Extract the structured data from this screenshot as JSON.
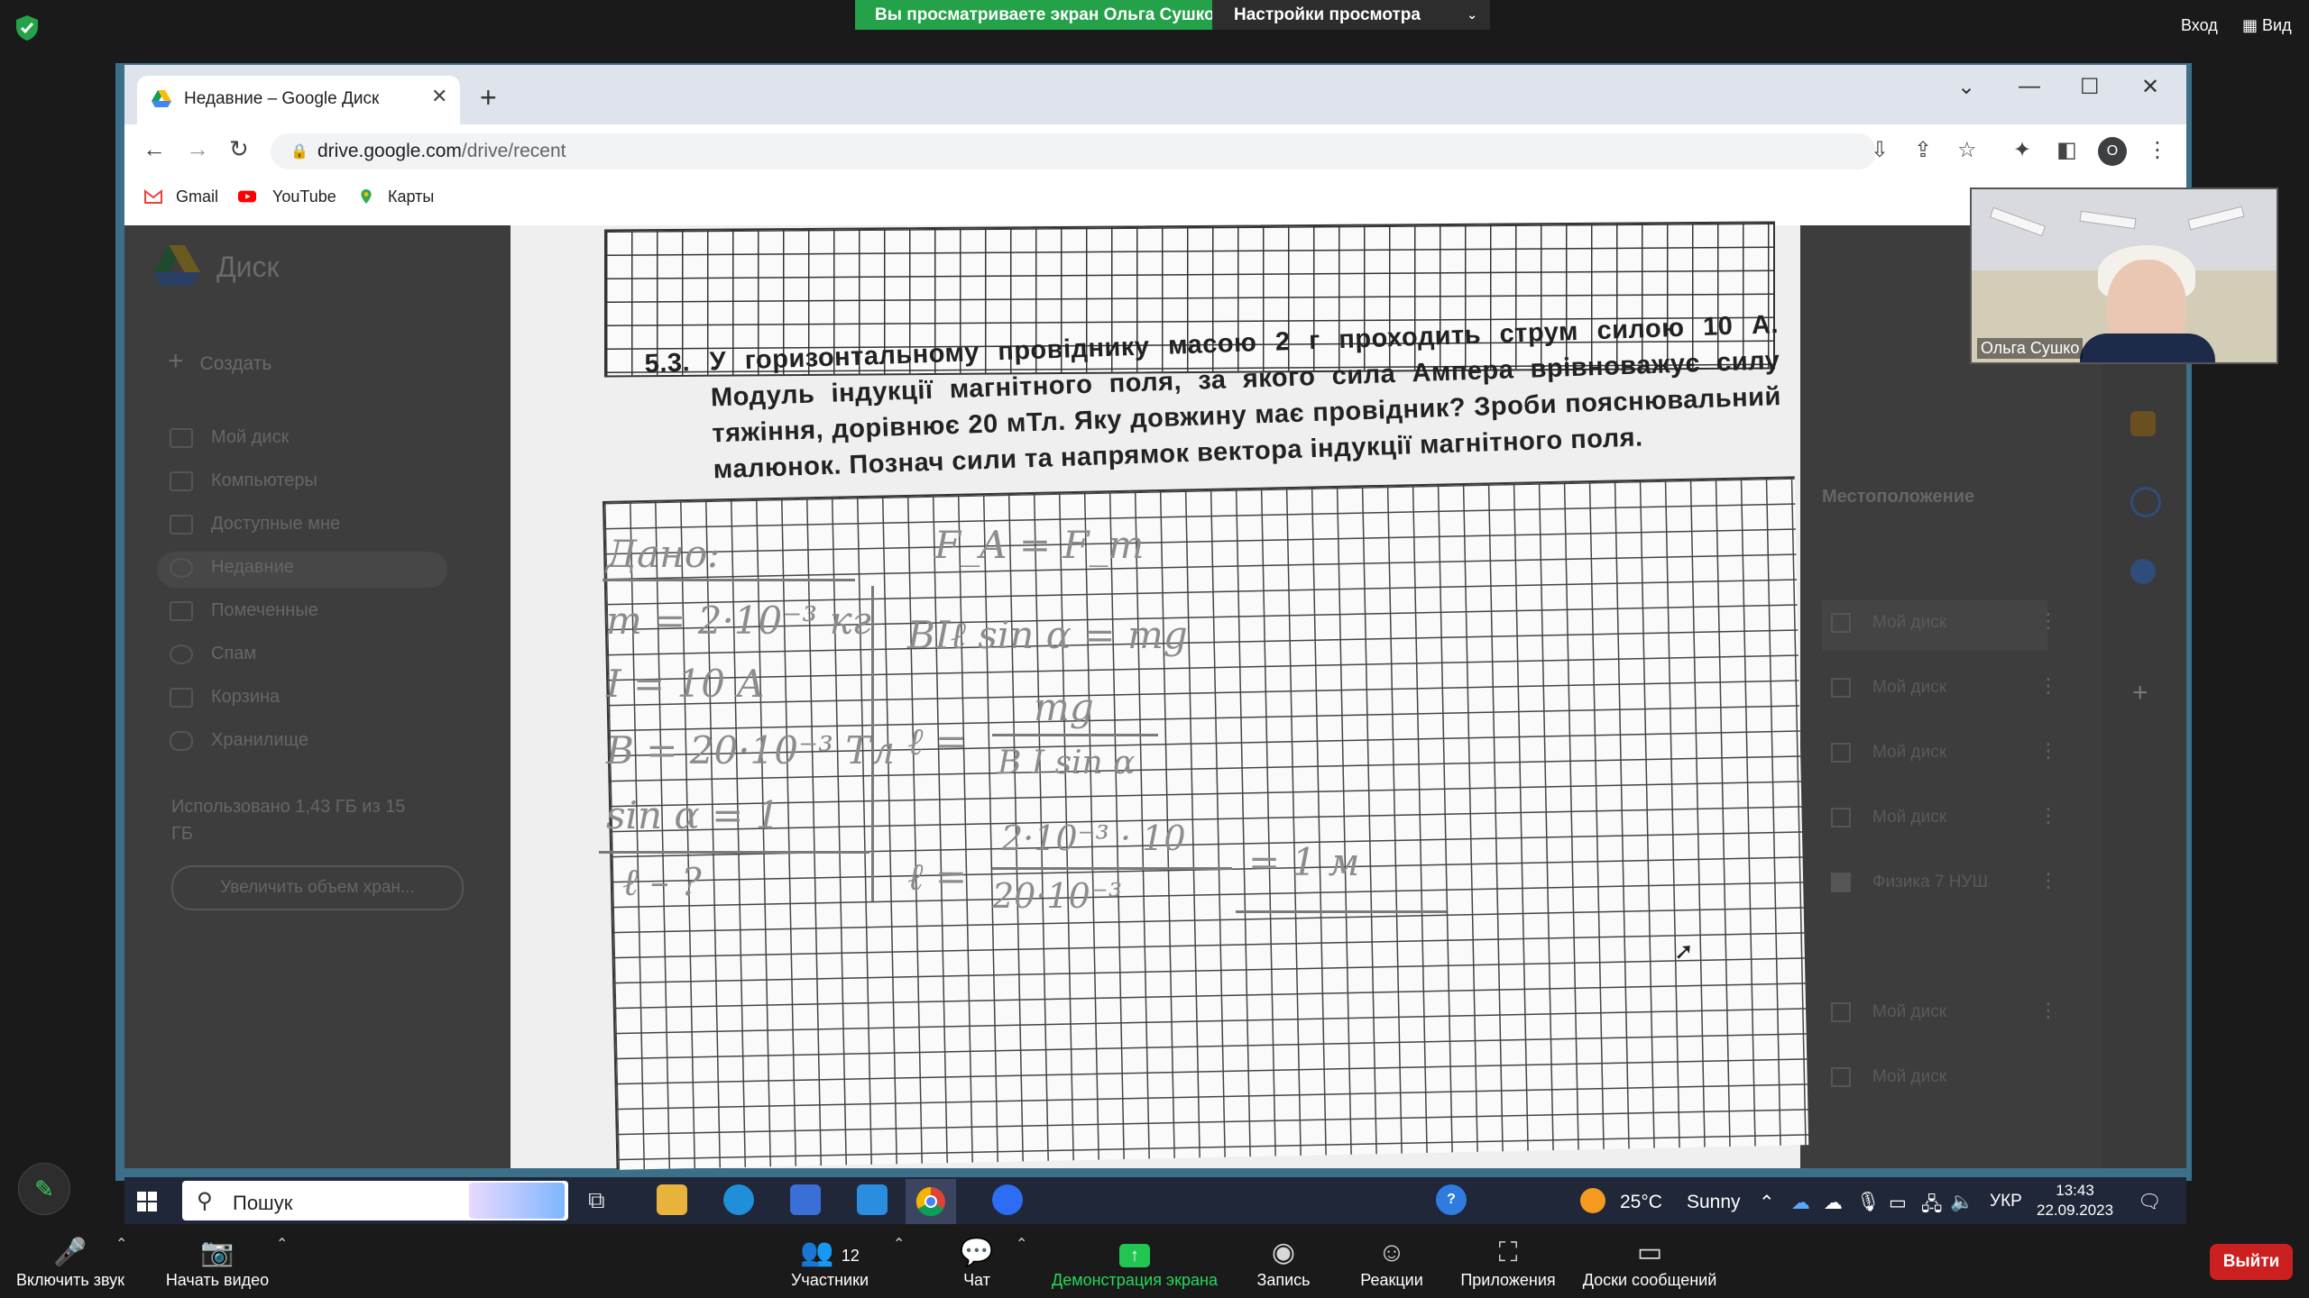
{
  "zoom": {
    "share_banner": "Вы просматриваете экран Ольга Сушко",
    "view_options": "Настройки просмотра",
    "top_right": {
      "signin": "Вход",
      "view": "Вид"
    },
    "toolbar": {
      "unmute": "Включить звук",
      "start_video": "Начать видео",
      "participants": "Участники",
      "participants_count": "12",
      "chat": "Чат",
      "share_screen": "Демонстрация экрана",
      "record": "Запись",
      "reactions": "Реакции",
      "apps": "Приложения",
      "whiteboards": "Доски сообщений",
      "leave": "Выйти"
    },
    "webcam_name": "Ольга Сушко"
  },
  "browser": {
    "tab_title": "Недавние – Google Диск",
    "url_host": "drive.google.com",
    "url_path": "/drive/recent",
    "profile_initial": "О",
    "bookmarks": [
      "Gmail",
      "YouTube",
      "Карты"
    ]
  },
  "drive": {
    "app_name": "Диск",
    "create": "Создать",
    "nav": [
      "Мой диск",
      "Компьютеры",
      "Доступные мне",
      "Недавние",
      "Помеченные",
      "Спам",
      "Корзина",
      "Хранилище"
    ],
    "storage_text": "Использовано 1,43 ГБ из 15 ГБ",
    "storage_button": "Увеличить объем хран...",
    "location_header": "Местоположение",
    "rows": [
      "Мой диск",
      "Мой диск",
      "Мой диск",
      "Мой диск",
      "Физика 7 НУШ",
      "Мой диск",
      "Мой диск"
    ]
  },
  "worksheet": {
    "number": "5.3.",
    "text": "У горизонтальному провіднику масою 2 г проходить струм силою 10 А. Модуль індукції магнітного поля, за якого сила Ампера врівноважує силу тяжіння, дорівнює 20 мТл. Яку довжину має провідник? Зроби пояснювальний малюнок. Познач сили та напрямок вектора індукції магнітного поля.",
    "handwriting": {
      "given": "Дано:",
      "m": "m = 2·10⁻³ кг",
      "i": "I = 10 A",
      "b": "B = 20·10⁻³ Тл",
      "sin": "sin α = 1",
      "find": "ℓ – ?",
      "eq1": "F_A = F_т",
      "eq2": "BIℓ sin α = mg",
      "eq3_lhs": "ℓ =",
      "eq3_num": "mg",
      "eq3_den": "B I sin α",
      "eq4_lhs": "ℓ =",
      "eq4_num": "2·10⁻³ · 10",
      "eq4_den": "20·10⁻³",
      "eq4_res": "= 1 м"
    }
  },
  "taskbar": {
    "search": "Пошук",
    "temperature": "25°C",
    "weather": "Sunny",
    "lang": "УКР",
    "time": "13:43",
    "date": "22.09.2023"
  },
  "colors": {
    "zoom_bg": "#1a1a1a",
    "share_green": "#24a24a",
    "leave_red": "#cc1f1f",
    "taskbar": "#1f2738"
  }
}
